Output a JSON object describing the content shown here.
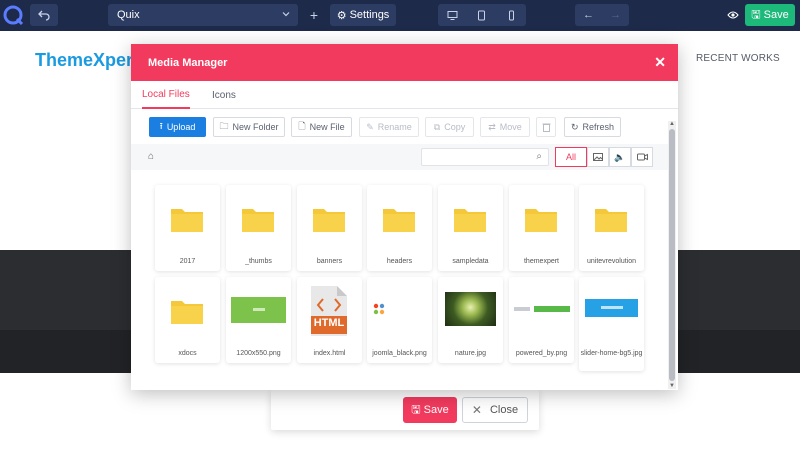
{
  "topbar": {
    "logo_letter": "Q",
    "page_select": "Quix",
    "plus": "+",
    "settings_label": "Settings",
    "save_label": "Save"
  },
  "background": {
    "site_logo": "ThemeXpert",
    "nav_recent": "RECENT WORKS"
  },
  "modal": {
    "title": "Media Manager",
    "tabs": [
      {
        "label": "Local Files",
        "active": true
      },
      {
        "label": "Icons",
        "active": false
      }
    ],
    "toolbar": {
      "upload": "Upload",
      "new_folder": "New Folder",
      "new_file": "New File",
      "rename": "Rename",
      "copy": "Copy",
      "move": "Move",
      "refresh": "Refresh"
    },
    "filters": {
      "all": "All"
    },
    "items": [
      {
        "name": "2017",
        "kind": "folder"
      },
      {
        "name": "_thumbs",
        "kind": "folder"
      },
      {
        "name": "banners",
        "kind": "folder"
      },
      {
        "name": "headers",
        "kind": "folder"
      },
      {
        "name": "sampledata",
        "kind": "folder"
      },
      {
        "name": "themexpert",
        "kind": "folder"
      },
      {
        "name": "unitevrevolution",
        "kind": "folder"
      },
      {
        "name": "xdocs",
        "kind": "folder"
      },
      {
        "name": "1200x550.png",
        "kind": "image"
      },
      {
        "name": "index.html",
        "kind": "html"
      },
      {
        "name": "joomla_black.png",
        "kind": "image"
      },
      {
        "name": "nature.jpg",
        "kind": "image"
      },
      {
        "name": "powered_by.png",
        "kind": "image"
      },
      {
        "name": "slider-home-bg5.jpg",
        "kind": "image"
      }
    ],
    "html_badge": "HTML"
  },
  "footer": {
    "save_label": "Save",
    "close_label": "Close"
  },
  "colors": {
    "accent": "#f23a5e",
    "primary": "#1a7fe0",
    "success": "#1db97a",
    "topbar": "#1d2a4a",
    "folder": "#f5c83a"
  }
}
